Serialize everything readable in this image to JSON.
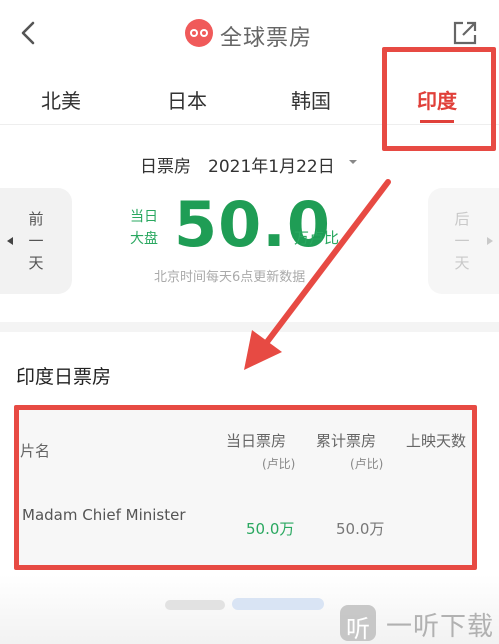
{
  "header": {
    "title": "全球票房"
  },
  "tabs": [
    {
      "label": "北美"
    },
    {
      "label": "日本"
    },
    {
      "label": "韩国"
    },
    {
      "label": "印度",
      "active": true
    }
  ],
  "date_row": {
    "label": "日票房",
    "value": "2021年1月22日"
  },
  "nav": {
    "prev": [
      "前",
      "一",
      "天"
    ],
    "next": [
      "后",
      "一",
      "天"
    ]
  },
  "summary": {
    "label_line1": "当日",
    "label_line2": "大盘",
    "value": "50.0",
    "unit": "万卢比",
    "note": "北京时间每天6点更新数据"
  },
  "section": {
    "title": "印度日票房"
  },
  "table": {
    "headers": [
      {
        "label": "片名",
        "sub": ""
      },
      {
        "label": "当日票房",
        "sub": "(卢比)"
      },
      {
        "label": "累计票房",
        "sub": "(卢比)"
      },
      {
        "label": "上映天数",
        "sub": ""
      }
    ],
    "rows": [
      {
        "title": "Madam Chief Minister",
        "daily": "50.0万",
        "total": "50.0万"
      }
    ]
  },
  "watermark": {
    "glyph": "听",
    "text": "一听下载"
  },
  "colors": {
    "accent_red": "#e0403a",
    "green": "#1f9d55",
    "annotation": "#e74a43"
  }
}
